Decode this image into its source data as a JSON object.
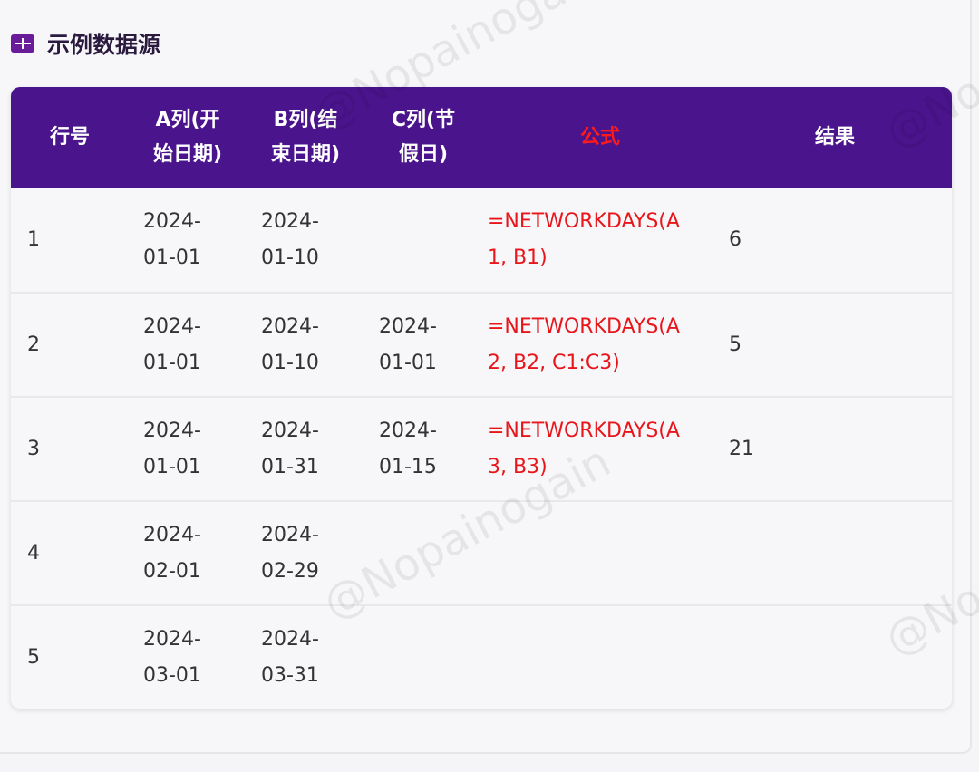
{
  "section": {
    "title": "示例数据源",
    "icon": "table-grid-icon"
  },
  "colors": {
    "header_bg": "#4a148c",
    "formula": "#e8161b",
    "icon": "#6a1b9a"
  },
  "table": {
    "headers": [
      "行号",
      "A列(开始日期)",
      "B列(结束日期)",
      "C列(节假日)",
      "公式",
      "结果"
    ],
    "rows": [
      {
        "no": "1",
        "a": "2024-01-01",
        "b": "2024-01-10",
        "c": "",
        "formula": "=NETWORKDAYS(A1, B1)",
        "result": "6"
      },
      {
        "no": "2",
        "a": "2024-01-01",
        "b": "2024-01-10",
        "c": "2024-01-01",
        "formula": "=NETWORKDAYS(A2, B2, C1:C3)",
        "result": "5"
      },
      {
        "no": "3",
        "a": "2024-01-01",
        "b": "2024-01-31",
        "c": "2024-01-15",
        "formula": "=NETWORKDAYS(A3, B3)",
        "result": "21"
      },
      {
        "no": "4",
        "a": "2024-02-01",
        "b": "2024-02-29",
        "c": "",
        "formula": "",
        "result": ""
      },
      {
        "no": "5",
        "a": "2024-03-01",
        "b": "2024-03-31",
        "c": "",
        "formula": "",
        "result": ""
      }
    ]
  },
  "watermark": "@Nopainogain"
}
